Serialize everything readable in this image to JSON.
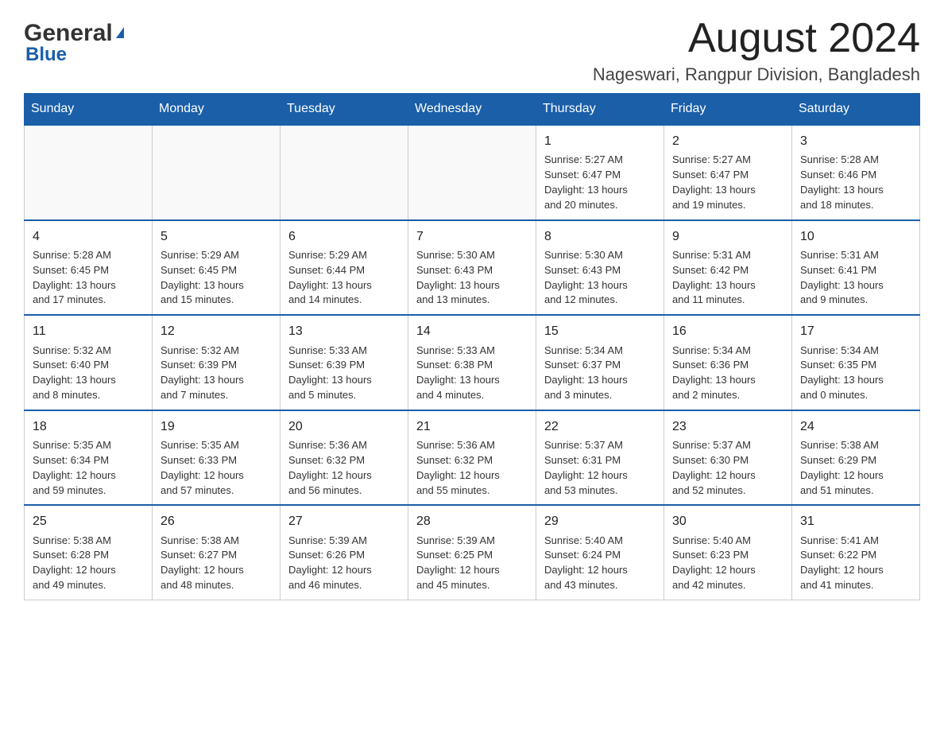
{
  "header": {
    "logo": {
      "general": "General",
      "blue": "Blue"
    },
    "month": "August 2024",
    "location": "Nageswari, Rangpur Division, Bangladesh"
  },
  "weekdays": [
    "Sunday",
    "Monday",
    "Tuesday",
    "Wednesday",
    "Thursday",
    "Friday",
    "Saturday"
  ],
  "weeks": [
    [
      {
        "day": "",
        "info": ""
      },
      {
        "day": "",
        "info": ""
      },
      {
        "day": "",
        "info": ""
      },
      {
        "day": "",
        "info": ""
      },
      {
        "day": "1",
        "info": "Sunrise: 5:27 AM\nSunset: 6:47 PM\nDaylight: 13 hours\nand 20 minutes."
      },
      {
        "day": "2",
        "info": "Sunrise: 5:27 AM\nSunset: 6:47 PM\nDaylight: 13 hours\nand 19 minutes."
      },
      {
        "day": "3",
        "info": "Sunrise: 5:28 AM\nSunset: 6:46 PM\nDaylight: 13 hours\nand 18 minutes."
      }
    ],
    [
      {
        "day": "4",
        "info": "Sunrise: 5:28 AM\nSunset: 6:45 PM\nDaylight: 13 hours\nand 17 minutes."
      },
      {
        "day": "5",
        "info": "Sunrise: 5:29 AM\nSunset: 6:45 PM\nDaylight: 13 hours\nand 15 minutes."
      },
      {
        "day": "6",
        "info": "Sunrise: 5:29 AM\nSunset: 6:44 PM\nDaylight: 13 hours\nand 14 minutes."
      },
      {
        "day": "7",
        "info": "Sunrise: 5:30 AM\nSunset: 6:43 PM\nDaylight: 13 hours\nand 13 minutes."
      },
      {
        "day": "8",
        "info": "Sunrise: 5:30 AM\nSunset: 6:43 PM\nDaylight: 13 hours\nand 12 minutes."
      },
      {
        "day": "9",
        "info": "Sunrise: 5:31 AM\nSunset: 6:42 PM\nDaylight: 13 hours\nand 11 minutes."
      },
      {
        "day": "10",
        "info": "Sunrise: 5:31 AM\nSunset: 6:41 PM\nDaylight: 13 hours\nand 9 minutes."
      }
    ],
    [
      {
        "day": "11",
        "info": "Sunrise: 5:32 AM\nSunset: 6:40 PM\nDaylight: 13 hours\nand 8 minutes."
      },
      {
        "day": "12",
        "info": "Sunrise: 5:32 AM\nSunset: 6:39 PM\nDaylight: 13 hours\nand 7 minutes."
      },
      {
        "day": "13",
        "info": "Sunrise: 5:33 AM\nSunset: 6:39 PM\nDaylight: 13 hours\nand 5 minutes."
      },
      {
        "day": "14",
        "info": "Sunrise: 5:33 AM\nSunset: 6:38 PM\nDaylight: 13 hours\nand 4 minutes."
      },
      {
        "day": "15",
        "info": "Sunrise: 5:34 AM\nSunset: 6:37 PM\nDaylight: 13 hours\nand 3 minutes."
      },
      {
        "day": "16",
        "info": "Sunrise: 5:34 AM\nSunset: 6:36 PM\nDaylight: 13 hours\nand 2 minutes."
      },
      {
        "day": "17",
        "info": "Sunrise: 5:34 AM\nSunset: 6:35 PM\nDaylight: 13 hours\nand 0 minutes."
      }
    ],
    [
      {
        "day": "18",
        "info": "Sunrise: 5:35 AM\nSunset: 6:34 PM\nDaylight: 12 hours\nand 59 minutes."
      },
      {
        "day": "19",
        "info": "Sunrise: 5:35 AM\nSunset: 6:33 PM\nDaylight: 12 hours\nand 57 minutes."
      },
      {
        "day": "20",
        "info": "Sunrise: 5:36 AM\nSunset: 6:32 PM\nDaylight: 12 hours\nand 56 minutes."
      },
      {
        "day": "21",
        "info": "Sunrise: 5:36 AM\nSunset: 6:32 PM\nDaylight: 12 hours\nand 55 minutes."
      },
      {
        "day": "22",
        "info": "Sunrise: 5:37 AM\nSunset: 6:31 PM\nDaylight: 12 hours\nand 53 minutes."
      },
      {
        "day": "23",
        "info": "Sunrise: 5:37 AM\nSunset: 6:30 PM\nDaylight: 12 hours\nand 52 minutes."
      },
      {
        "day": "24",
        "info": "Sunrise: 5:38 AM\nSunset: 6:29 PM\nDaylight: 12 hours\nand 51 minutes."
      }
    ],
    [
      {
        "day": "25",
        "info": "Sunrise: 5:38 AM\nSunset: 6:28 PM\nDaylight: 12 hours\nand 49 minutes."
      },
      {
        "day": "26",
        "info": "Sunrise: 5:38 AM\nSunset: 6:27 PM\nDaylight: 12 hours\nand 48 minutes."
      },
      {
        "day": "27",
        "info": "Sunrise: 5:39 AM\nSunset: 6:26 PM\nDaylight: 12 hours\nand 46 minutes."
      },
      {
        "day": "28",
        "info": "Sunrise: 5:39 AM\nSunset: 6:25 PM\nDaylight: 12 hours\nand 45 minutes."
      },
      {
        "day": "29",
        "info": "Sunrise: 5:40 AM\nSunset: 6:24 PM\nDaylight: 12 hours\nand 43 minutes."
      },
      {
        "day": "30",
        "info": "Sunrise: 5:40 AM\nSunset: 6:23 PM\nDaylight: 12 hours\nand 42 minutes."
      },
      {
        "day": "31",
        "info": "Sunrise: 5:41 AM\nSunset: 6:22 PM\nDaylight: 12 hours\nand 41 minutes."
      }
    ]
  ]
}
